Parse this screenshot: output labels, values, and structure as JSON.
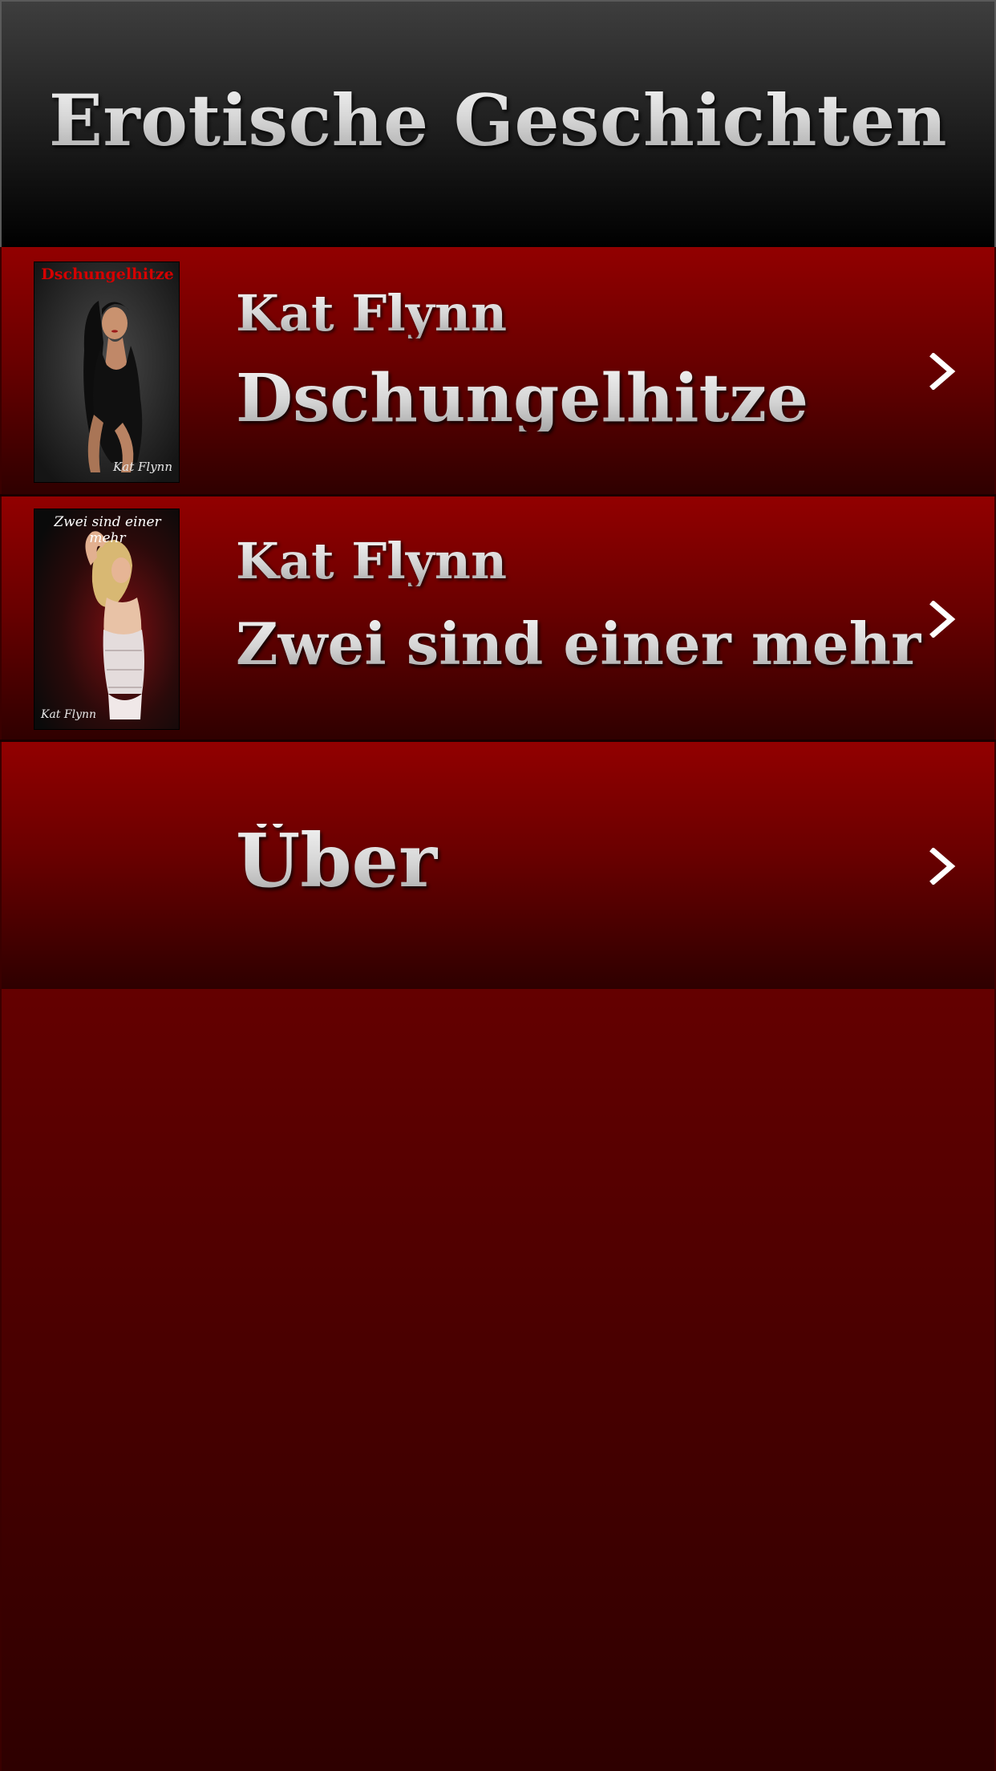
{
  "header": {
    "title": "Erotische Geschichten"
  },
  "books": [
    {
      "author": "Kat Flynn",
      "title": "Dschungelhitze",
      "cover_title": "Dschungelhitze",
      "cover_author": "Kat Flynn",
      "cover_title_color": "#d40000"
    },
    {
      "author": "Kat Flynn",
      "title": "Zwei sind einer mehr",
      "cover_title": "Zwei sind einer mehr",
      "cover_author": "Kat Flynn",
      "cover_title_color": "#ffffff"
    }
  ],
  "about": {
    "label": "Über"
  },
  "icons": {
    "row_chevron": "chevron-right-icon"
  },
  "colors": {
    "header_top": "#3e3e3e",
    "header_bottom": "#000000",
    "row_top": "#920000",
    "row_bottom": "#2e0000",
    "background_top": "#640000",
    "background_bottom": "#2e0000",
    "text_silver": "#d4d4d4"
  }
}
